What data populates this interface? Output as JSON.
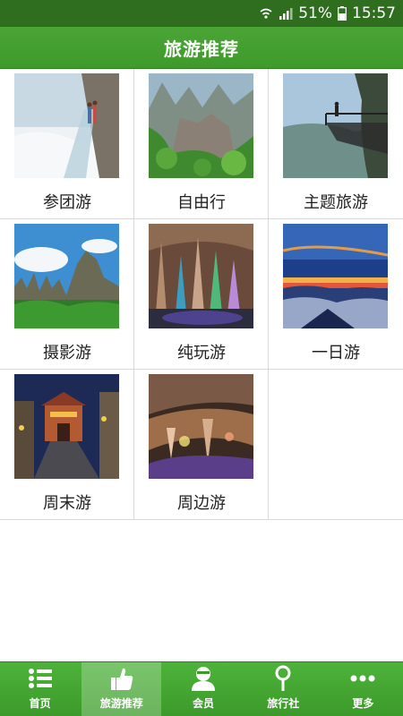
{
  "status_bar": {
    "battery": "51%",
    "time": "15:57",
    "icons": [
      "wifi-icon",
      "signal-icon",
      "battery-icon"
    ]
  },
  "header": {
    "title": "旅游推荐"
  },
  "grid": [
    {
      "label": "参团游",
      "image": "glass-cliff-walkway-photo"
    },
    {
      "label": "自由行",
      "image": "mountain-valley-photo"
    },
    {
      "label": "主题旅游",
      "image": "glass-viewing-platform-photo"
    },
    {
      "label": "摄影游",
      "image": "karst-peaks-photo"
    },
    {
      "label": "纯玩游",
      "image": "cave-stalagmites-photo"
    },
    {
      "label": "一日游",
      "image": "sunset-sea-of-clouds-photo"
    },
    {
      "label": "周末游",
      "image": "ancient-town-night-photo"
    },
    {
      "label": "周边游",
      "image": "lit-cave-photo"
    }
  ],
  "tabs": [
    {
      "label": "首页",
      "icon": "list-icon",
      "active": false
    },
    {
      "label": "旅游推荐",
      "icon": "thumbs-up-icon",
      "active": true
    },
    {
      "label": "会员",
      "icon": "user-icon",
      "active": false
    },
    {
      "label": "旅行社",
      "icon": "location-pin-icon",
      "active": false
    },
    {
      "label": "更多",
      "icon": "more-dots-icon",
      "active": false
    }
  ],
  "colors": {
    "header_green": "#45a232",
    "statusbar_green": "#2f6d1f",
    "tab_green": "#45a834"
  }
}
